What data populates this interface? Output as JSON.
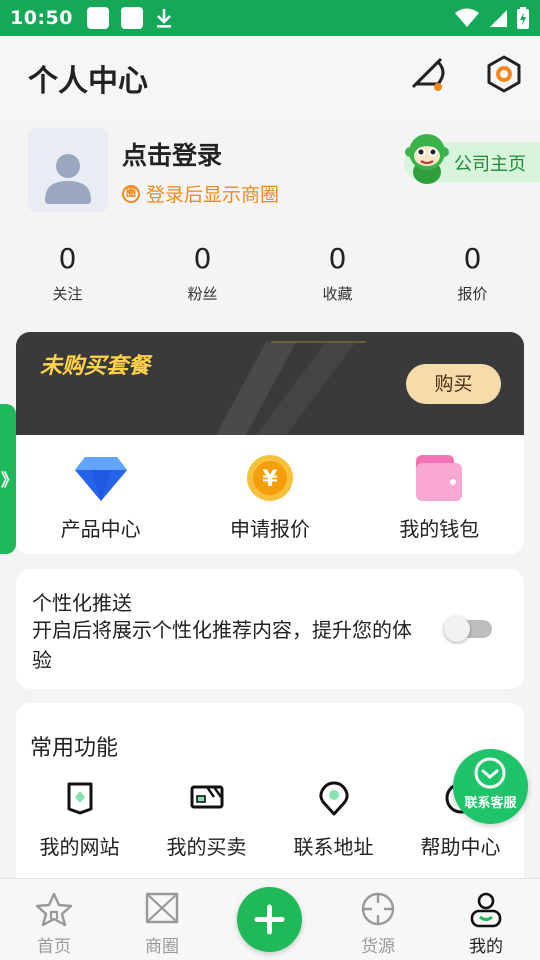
{
  "status_bar": {
    "time": "10:50"
  },
  "header": {
    "title": "个人中心"
  },
  "profile": {
    "login_title": "点击登录",
    "login_subtitle": "登录后显示商圈",
    "company_home": "公司主页",
    "stats": [
      {
        "value": "0",
        "label": "关注"
      },
      {
        "value": "0",
        "label": "粉丝"
      },
      {
        "value": "0",
        "label": "收藏"
      },
      {
        "value": "0",
        "label": "报价"
      }
    ]
  },
  "package_banner": {
    "title": "未购买套餐",
    "buy_label": "购买"
  },
  "quick_actions": [
    {
      "label": "产品中心",
      "icon": "diamond-icon"
    },
    {
      "label": "申请报价",
      "icon": "yuan-coin-icon"
    },
    {
      "label": "我的钱包",
      "icon": "wallet-icon"
    }
  ],
  "side_tab": {
    "label": "》"
  },
  "personalized_push": {
    "title": "个性化推送",
    "description": "开启后将展示个性化推荐内容，提升您的体验",
    "enabled": false
  },
  "common_functions": {
    "title": "常用功能",
    "items": [
      {
        "label": "我的网站",
        "icon": "website-icon"
      },
      {
        "label": "我的买卖",
        "icon": "trade-icon"
      },
      {
        "label": "联系地址",
        "icon": "location-icon"
      },
      {
        "label": "帮助中心",
        "icon": "help-icon"
      }
    ]
  },
  "customer_service": {
    "label": "联系客服"
  },
  "bottom_nav": [
    {
      "label": "首页",
      "icon": "home-icon",
      "active": false
    },
    {
      "label": "商圈",
      "icon": "business-circle-icon",
      "active": false
    },
    {
      "label": "",
      "icon": "add-icon",
      "active": false
    },
    {
      "label": "货源",
      "icon": "supply-icon",
      "active": false
    },
    {
      "label": "我的",
      "icon": "profile-icon",
      "active": true
    }
  ],
  "colors": {
    "primary_green": "#14a857",
    "accent_orange": "#f08a1f",
    "banner_gold": "#ffd24a",
    "banner_dark": "#3a3a3a"
  }
}
